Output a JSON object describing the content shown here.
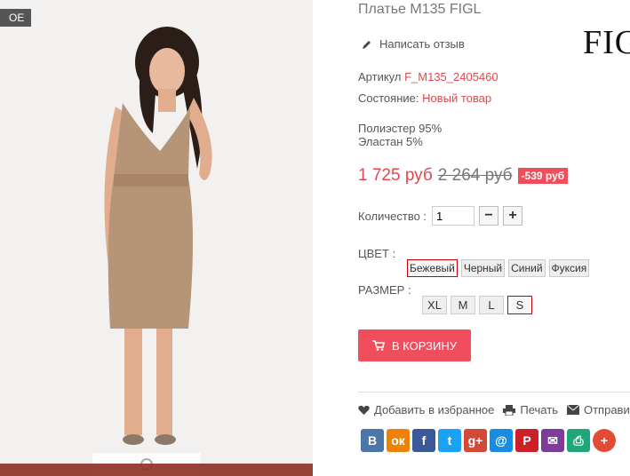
{
  "photo": {
    "badge": "OE"
  },
  "product": {
    "title": "Платье M135 FIGL",
    "brand": "FIG",
    "review_link": "Написать отзыв",
    "sku_label": "Артикул",
    "sku_value": "F_M135_2405460",
    "condition_label": "Состояние:",
    "condition_value": "Новый товар",
    "material_1": "Полиэстер 95%",
    "material_2": "Эластан 5%",
    "price_new": "1 725 руб",
    "price_old": "2 264 руб",
    "discount": "-539 руб"
  },
  "quantity": {
    "label": "Количество :",
    "value": "1",
    "minus": "−",
    "plus": "+"
  },
  "color": {
    "label": "ЦВЕТ :",
    "options": [
      "Бежевый",
      "Черный",
      "Синий",
      "Фуксия"
    ],
    "selected": "Бежевый"
  },
  "size": {
    "label": "РАЗМЕР :",
    "options": [
      "XL",
      "M",
      "L",
      "S"
    ],
    "selected": "S"
  },
  "cart_button": "В КОРЗИНУ",
  "actions": {
    "favorite": "Добавить в избранное",
    "print": "Печать",
    "send": "Отправит"
  },
  "social": [
    {
      "icon": "vk-icon",
      "glyph": "В",
      "color": "#4a76a8"
    },
    {
      "icon": "odnoklassniki-icon",
      "glyph": "ок",
      "color": "#ee8208"
    },
    {
      "icon": "facebook-icon",
      "glyph": "f",
      "color": "#3b5998"
    },
    {
      "icon": "twitter-icon",
      "glyph": "t",
      "color": "#1da1f2"
    },
    {
      "icon": "google-plus-icon",
      "glyph": "g+",
      "color": "#d34836"
    },
    {
      "icon": "mail-ru-icon",
      "glyph": "@",
      "color": "#168de2"
    },
    {
      "icon": "pinterest-icon",
      "glyph": "P",
      "color": "#cb2027"
    },
    {
      "icon": "email-icon",
      "glyph": "✉",
      "color": "#7d3c98"
    },
    {
      "icon": "print-icon",
      "glyph": "⎙",
      "color": "#1fa67a"
    },
    {
      "icon": "more-icon",
      "glyph": "+",
      "color": "#e24b34"
    }
  ]
}
